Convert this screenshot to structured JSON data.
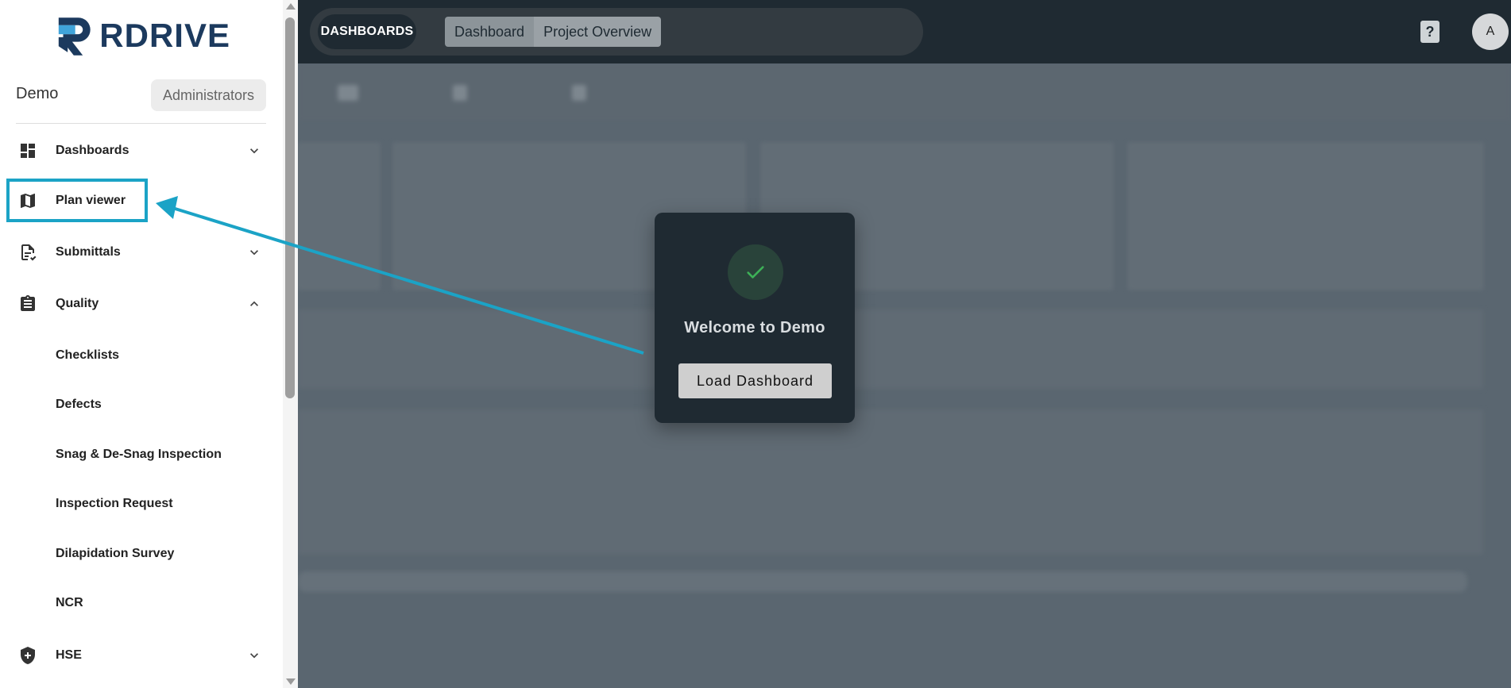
{
  "brand": {
    "logo_text": "RDRIVE"
  },
  "topbar": {
    "section_label": "DASHBOARDS",
    "tabs": [
      {
        "label": "Dashboard"
      },
      {
        "label": "Project Overview"
      }
    ],
    "help_label": "?",
    "avatar_initial": "A"
  },
  "sidebar": {
    "project_name": "Demo",
    "role": "Administrators",
    "items": [
      {
        "label": "Dashboards",
        "icon": "dashboard-icon",
        "expandable": true,
        "expanded": false
      },
      {
        "label": "Plan viewer",
        "icon": "map-icon",
        "expandable": false
      },
      {
        "label": "Submittals",
        "icon": "document-check-icon",
        "expandable": true,
        "expanded": false
      },
      {
        "label": "Quality",
        "icon": "clipboard-icon",
        "expandable": true,
        "expanded": true
      },
      {
        "label": "HSE",
        "icon": "shield-plus-icon",
        "expandable": true,
        "expanded": false
      }
    ],
    "quality_subitems": [
      {
        "label": "Checklists"
      },
      {
        "label": "Defects"
      },
      {
        "label": "Snag & De-Snag Inspection"
      },
      {
        "label": "Inspection Request"
      },
      {
        "label": "Dilapidation Survey"
      },
      {
        "label": "NCR"
      }
    ]
  },
  "modal": {
    "title": "Welcome to Demo",
    "button_label": "Load Dashboard",
    "icon": "check-icon"
  },
  "colors": {
    "topbar_bg": "#1f2a32",
    "highlight": "#1ba3c6",
    "success_check": "#3db057",
    "logo_navy": "#1c3a5e"
  }
}
